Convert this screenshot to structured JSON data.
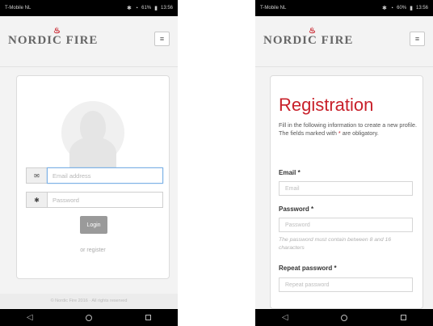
{
  "left": {
    "status": {
      "carrier": "T-Mobile NL",
      "signal": "61%",
      "time": "13:56"
    },
    "brand": {
      "logo_text": "NORDIC FIRE"
    },
    "login": {
      "email_placeholder": "Email address",
      "password_placeholder": "Password",
      "login_button": "Login",
      "register_link": "or register"
    },
    "footer": {
      "text": "© Nordic Fire 2016 · All rights reserved"
    }
  },
  "right": {
    "status": {
      "carrier": "T-Mobile NL",
      "signal": "60%",
      "time": "13:56"
    },
    "brand": {
      "logo_text": "NORDIC FIRE"
    },
    "registration": {
      "title": "Registration",
      "intro_line1": "Fill in the following information to create a new profile.",
      "intro_line2_prefix": "The fields marked with",
      "intro_star": "*",
      "intro_line2_suffix": "are obligatory.",
      "email_label": "Email *",
      "email_placeholder": "Email",
      "password_label": "Password *",
      "password_placeholder": "Password",
      "password_hint": "The password must contain between 8 and 16 characters",
      "repeat_label": "Repeat password *",
      "repeat_placeholder": "Repeat password"
    }
  },
  "colors": {
    "brand_red": "#c8202a",
    "card_bg": "#ffffff",
    "page_bg": "#f3f3f3"
  },
  "icons": [
    "envelope-icon",
    "asterisk-icon",
    "hamburger-menu-icon",
    "back-icon",
    "home-icon",
    "recent-apps-icon",
    "flame-icon"
  ]
}
